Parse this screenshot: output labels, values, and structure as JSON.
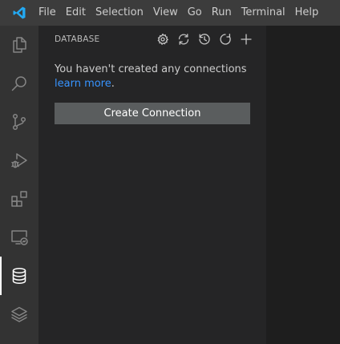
{
  "menu": {
    "items": [
      "File",
      "Edit",
      "Selection",
      "View",
      "Go",
      "Run",
      "Terminal",
      "Help"
    ]
  },
  "activity_bar": {
    "items": [
      {
        "icon": "files-icon"
      },
      {
        "icon": "search-icon"
      },
      {
        "icon": "source-control-icon"
      },
      {
        "icon": "run-debug-icon"
      },
      {
        "icon": "extensions-icon"
      },
      {
        "icon": "remote-explorer-icon"
      },
      {
        "icon": "database-icon",
        "active": true
      },
      {
        "icon": "layers-icon"
      }
    ]
  },
  "sidebar": {
    "title": "DATABASE",
    "actions": [
      "settings-icon",
      "sync-icon",
      "history-icon",
      "refresh-icon",
      "add-icon"
    ],
    "welcome_text": "You haven't created any connections ",
    "welcome_link": "learn more",
    "welcome_end": ".",
    "create_button_label": "Create Connection"
  },
  "colors": {
    "menubar_bg": "#3c3c3c",
    "activitybar_bg": "#333333",
    "sidebar_bg": "#252526",
    "editor_bg": "#1e1e1e",
    "link": "#3794ff",
    "button_bg": "#5a5d5e",
    "vscode_blue": "#23a9f2"
  }
}
